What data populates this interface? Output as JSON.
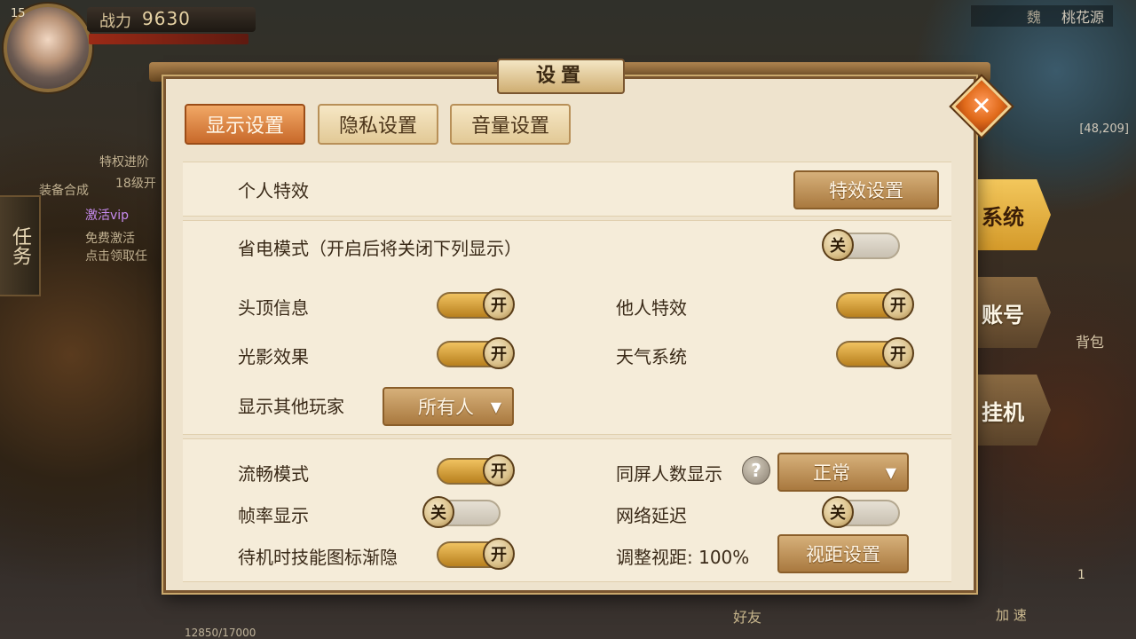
{
  "hud": {
    "level": "15",
    "power_label": "战力",
    "power_value": "9630",
    "region": "魏",
    "location": "桃花源",
    "coords": "[48,209]",
    "task_tab": "任务",
    "side_texts": [
      "装备合成",
      "特权进阶",
      "18级开",
      "激活vip",
      "免费激活",
      "点击领取任"
    ],
    "bag_label": "背包",
    "friends_label": "好友",
    "speed_label": "加 速",
    "exp_text": "12850/17000",
    "side_num": "1"
  },
  "side_menu": [
    {
      "label": "系统",
      "active": true
    },
    {
      "label": "账号",
      "active": false
    },
    {
      "label": "挂机",
      "active": false
    }
  ],
  "dialog": {
    "title": "设置",
    "close_icon": "close-icon",
    "tabs": [
      {
        "label": "显示设置",
        "active": true
      },
      {
        "label": "隐私设置",
        "active": false
      },
      {
        "label": "音量设置",
        "active": false
      }
    ],
    "personal_effects": {
      "label": "个人特效",
      "button": "特效设置"
    },
    "power_saving": {
      "label": "省电模式（开启后将关闭下列显示）",
      "state": "关"
    },
    "head_info": {
      "label": "头顶信息",
      "state": "开"
    },
    "others_effects": {
      "label": "他人特效",
      "state": "开"
    },
    "light_shadow": {
      "label": "光影效果",
      "state": "开"
    },
    "weather": {
      "label": "天气系统",
      "state": "开"
    },
    "show_players": {
      "label": "显示其他玩家",
      "value": "所有人"
    },
    "smooth_mode": {
      "label": "流畅模式",
      "state": "开"
    },
    "same_screen": {
      "label": "同屏人数显示",
      "value": "正常"
    },
    "fps_display": {
      "label": "帧率显示",
      "state": "关"
    },
    "latency": {
      "label": "网络延迟",
      "state": "关"
    },
    "idle_fade": {
      "label": "待机时技能图标渐隐",
      "state": "开"
    },
    "view_distance": {
      "label": "调整视距: 100%",
      "button": "视距设置"
    }
  }
}
